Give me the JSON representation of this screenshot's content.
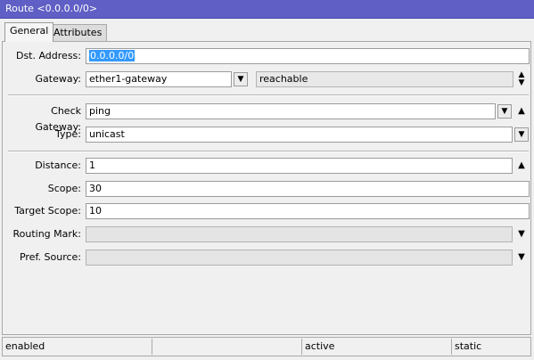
{
  "window": {
    "title": "Route <0.0.0.0/0>"
  },
  "tabs": [
    {
      "label": "General"
    },
    {
      "label": "Attributes"
    }
  ],
  "form": {
    "dst_address": {
      "label": "Dst. Address:",
      "value": "0.0.0.0/0"
    },
    "gateway": {
      "label": "Gateway:",
      "value": "ether1-gateway",
      "status": "reachable"
    },
    "check_gateway": {
      "label": "Check Gateway:",
      "value": "ping"
    },
    "type": {
      "label": "Type:",
      "value": "unicast"
    },
    "distance": {
      "label": "Distance:",
      "value": "1"
    },
    "scope": {
      "label": "Scope:",
      "value": "30"
    },
    "target_scope": {
      "label": "Target Scope:",
      "value": "10"
    },
    "routing_mark": {
      "label": "Routing Mark:",
      "value": ""
    },
    "pref_source": {
      "label": "Pref. Source:",
      "value": ""
    }
  },
  "status": {
    "cells": [
      "enabled",
      "",
      "active",
      "static"
    ]
  },
  "icons": {
    "dropdown": "dropdown-icon",
    "up_arrow": "up-arrow-icon",
    "down_arrow": "down-arrow-icon",
    "updown_arrow": "updown-arrow-icon"
  }
}
